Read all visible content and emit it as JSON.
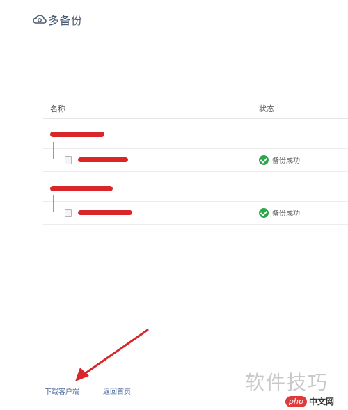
{
  "header": {
    "title": "多备份",
    "logo_icon": "cloud-icon"
  },
  "table": {
    "columns": [
      "名称",
      "状态"
    ],
    "rows": [
      {
        "status_label": "备份成功",
        "status_icon": "check-circle-icon"
      },
      {
        "status_label": "备份成功",
        "status_icon": "check-circle-icon"
      }
    ]
  },
  "footer": {
    "download_client": "下载客户端",
    "back_home": "返回首页"
  },
  "watermark": {
    "text": "软件技巧",
    "site_badge": "php",
    "site_name": "中文网"
  },
  "colors": {
    "success": "#2ba84a",
    "annotation": "#d8262b",
    "link": "#4a6a9a"
  }
}
